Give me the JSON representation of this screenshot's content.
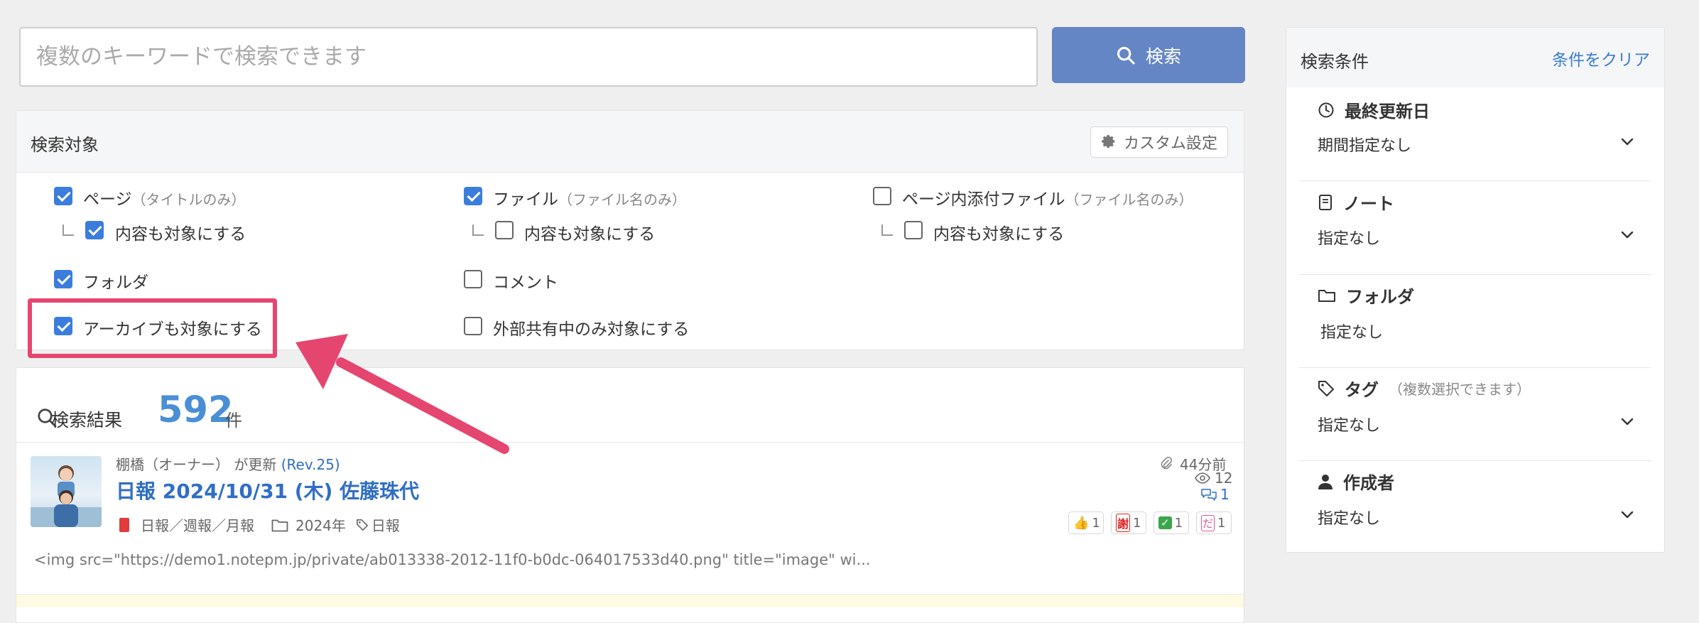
{
  "search": {
    "placeholder": "複数のキーワードで検索できます",
    "button_label": "検索"
  },
  "target": {
    "title": "検索対象",
    "custom_button": "カスタム設定",
    "options": {
      "page": {
        "label": "ページ",
        "sub": "（タイトルのみ）",
        "checked": true
      },
      "page_content": {
        "label": "内容も対象にする",
        "checked": true
      },
      "file": {
        "label": "ファイル",
        "sub": "（ファイル名のみ）",
        "checked": true
      },
      "file_content": {
        "label": "内容も対象にする",
        "checked": false
      },
      "attach": {
        "label": "ページ内添付ファイル",
        "sub": "（ファイル名のみ）",
        "checked": false
      },
      "attach_content": {
        "label": "内容も対象にする",
        "checked": false
      },
      "folder": {
        "label": "フォルダ",
        "checked": true
      },
      "comment": {
        "label": "コメント",
        "checked": false
      },
      "archive": {
        "label": "アーカイブも対象にする",
        "checked": true
      },
      "external": {
        "label": "外部共有中のみ対象にする",
        "checked": false
      }
    }
  },
  "results": {
    "label": "検索結果",
    "count": "592",
    "unit": "件",
    "items": [
      {
        "author_line": "棚橋（オーナー） が更新",
        "rev": "(Rev.25)",
        "title": "日報 2024/10/31 (木) 佐藤珠代",
        "note": "日報／週報／月報",
        "folder": "2024年",
        "tag": "日報",
        "time": "44分前",
        "views": "12",
        "comments": "1",
        "reactions": [
          {
            "icon": "thumbs-up",
            "glyph": "👍",
            "count": "1"
          },
          {
            "icon": "stamp-red",
            "glyph": "謝",
            "count": "1"
          },
          {
            "icon": "check-green",
            "glyph": "✓",
            "count": "1"
          },
          {
            "icon": "stamp-pink",
            "glyph": "だ",
            "count": "1"
          }
        ],
        "snippet": "<img src=\"https://demo1.notepm.jp/private/ab013338-2012-11f0-b0dc-064017533d40.png\" title=\"image\" wi..."
      }
    ]
  },
  "sidebar": {
    "title": "検索条件",
    "clear": "条件をクリア",
    "sections": [
      {
        "icon": "clock-icon",
        "title": "最終更新日",
        "value": "期間指定なし",
        "dropdown": true
      },
      {
        "icon": "notebook-icon",
        "title": "ノート",
        "value": "指定なし",
        "dropdown": true
      },
      {
        "icon": "folder-icon",
        "title": "フォルダ",
        "value": "指定なし",
        "dropdown": false
      },
      {
        "icon": "tag-icon",
        "title": "タグ",
        "sub": "（複数選択できます）",
        "value": "指定なし",
        "dropdown": true
      },
      {
        "icon": "person-icon",
        "title": "作成者",
        "value": "指定なし",
        "dropdown": true
      }
    ]
  },
  "colors": {
    "accent": "#6486c4",
    "link": "#2f6ec4",
    "count": "#4a8ed6",
    "highlight": "#e5466f",
    "checkbox": "#3b7ddd"
  }
}
